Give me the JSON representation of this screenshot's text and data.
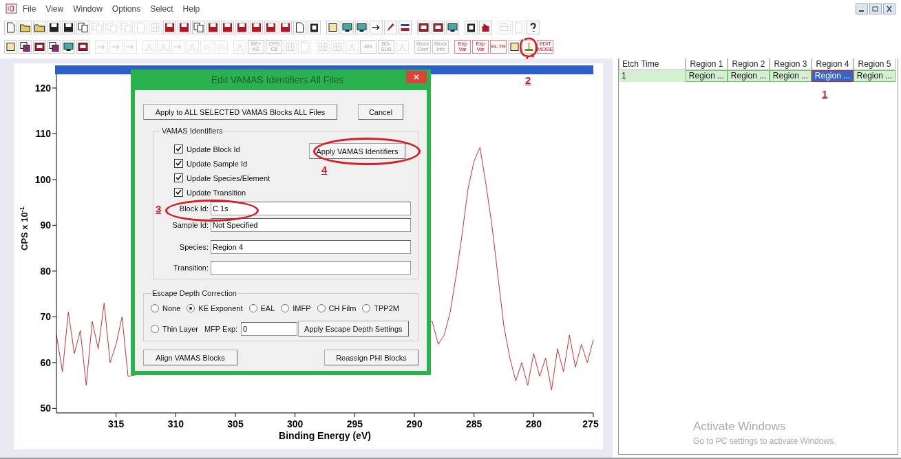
{
  "menu_bar": {
    "items": [
      "File",
      "View",
      "Window",
      "Options",
      "Select",
      "Help"
    ]
  },
  "toolbars": [
    {
      "groups": [
        {
          "items": [
            {
              "kind": "icon",
              "disabled": false
            },
            {
              "kind": "icon",
              "disabled": false
            },
            {
              "kind": "icon",
              "disabled": false
            },
            {
              "kind": "icon",
              "disabled": false
            },
            {
              "kind": "icon",
              "disabled": false
            },
            {
              "kind": "icon",
              "disabled": false
            },
            {
              "kind": "icon",
              "disabled": true
            },
            {
              "kind": "icon",
              "disabled": true
            },
            {
              "kind": "icon",
              "disabled": true
            },
            {
              "kind": "icon",
              "disabled": true
            },
            {
              "kind": "icon",
              "disabled": true
            },
            {
              "kind": "icon",
              "disabled": false
            },
            {
              "kind": "icon",
              "disabled": false
            },
            {
              "kind": "icon",
              "disabled": false
            },
            {
              "kind": "icon",
              "disabled": false
            },
            {
              "kind": "icon",
              "disabled": false
            },
            {
              "kind": "icon",
              "disabled": false
            },
            {
              "kind": "icon",
              "disabled": false
            },
            {
              "kind": "icon",
              "disabled": false
            },
            {
              "kind": "icon",
              "disabled": false
            },
            {
              "kind": "icon",
              "disabled": false
            },
            {
              "kind": "icon",
              "disabled": false
            }
          ]
        },
        {
          "items": [
            {
              "kind": "icon",
              "disabled": false
            },
            {
              "kind": "icon",
              "disabled": false
            },
            {
              "kind": "icon",
              "disabled": false
            },
            {
              "kind": "icon",
              "disabled": false
            },
            {
              "kind": "icon",
              "disabled": false
            },
            {
              "kind": "icon",
              "disabled": false
            }
          ]
        },
        {
          "items": [
            {
              "kind": "icon",
              "disabled": false
            },
            {
              "kind": "icon",
              "disabled": false
            },
            {
              "kind": "icon",
              "disabled": false
            }
          ]
        },
        {
          "items": [
            {
              "kind": "icon",
              "disabled": false
            },
            {
              "kind": "icon",
              "disabled": false
            }
          ]
        },
        {
          "items": [
            {
              "kind": "icon",
              "disabled": true
            },
            {
              "kind": "icon",
              "disabled": true
            },
            {
              "kind": "icon",
              "disabled": false
            }
          ]
        }
      ]
    },
    {
      "groups": [
        {
          "items": [
            {
              "kind": "icon",
              "disabled": false
            },
            {
              "kind": "icon",
              "disabled": false
            },
            {
              "kind": "icon",
              "disabled": false
            },
            {
              "kind": "icon",
              "disabled": false
            },
            {
              "kind": "icon",
              "disabled": false
            },
            {
              "kind": "icon",
              "disabled": false
            }
          ]
        },
        {
          "items": [
            {
              "kind": "icon",
              "disabled": true
            },
            {
              "kind": "icon",
              "disabled": true
            },
            {
              "kind": "icon",
              "disabled": true
            }
          ]
        },
        {
          "items": [
            {
              "kind": "icon",
              "disabled": true
            },
            {
              "kind": "icon",
              "disabled": true
            },
            {
              "kind": "icon",
              "disabled": true
            },
            {
              "kind": "icon",
              "disabled": true
            },
            {
              "kind": "icon",
              "disabled": true
            },
            {
              "kind": "icon",
              "disabled": true
            }
          ]
        },
        {
          "items": [
            {
              "kind": "icon",
              "disabled": true
            },
            {
              "kind": "text",
              "label": "BE+ KE",
              "disabled": true
            },
            {
              "kind": "text",
              "label": "CPS C$",
              "disabled": true
            },
            {
              "kind": "icon",
              "disabled": true
            },
            {
              "kind": "icon",
              "disabled": true
            }
          ]
        },
        {
          "items": [
            {
              "kind": "icon",
              "disabled": true
            },
            {
              "kind": "icon",
              "disabled": true
            },
            {
              "kind": "icon",
              "disabled": true
            },
            {
              "kind": "text",
              "label": "BG",
              "disabled": true
            },
            {
              "kind": "text",
              "label": "BG- SUB",
              "disabled": true
            },
            {
              "kind": "icon",
              "disabled": true
            }
          ]
        },
        {
          "items": [
            {
              "kind": "text",
              "label": "Block Cont",
              "disabled": true
            },
            {
              "kind": "text",
              "label": "Block Info",
              "disabled": true
            }
          ]
        },
        {
          "items": [
            {
              "kind": "text",
              "label": "Exp Var",
              "disabled": false
            },
            {
              "kind": "text",
              "label": "Exp Var",
              "disabled": false
            },
            {
              "kind": "text",
              "label": "EL TR",
              "disabled": false
            },
            {
              "kind": "icon",
              "disabled": false
            },
            {
              "kind": "icon",
              "disabled": false
            },
            {
              "kind": "text",
              "label": "EDIT MODE",
              "disabled": false
            }
          ]
        }
      ]
    }
  ],
  "chart": {
    "chart_data": {
      "type": "line",
      "xlabel": "Binding Energy (eV)",
      "ylabel": "CPS x 10$^{-1}$",
      "xlim": [
        320,
        275
      ],
      "ylim": [
        49,
        123
      ],
      "xticks": [
        315,
        310,
        305,
        300,
        295,
        290,
        285,
        280,
        275
      ],
      "yticks": [
        120,
        110,
        100,
        90,
        80,
        70,
        60,
        50
      ],
      "x": [
        320,
        319.5,
        319,
        318.5,
        318,
        317.5,
        317,
        316.5,
        316,
        315.5,
        315,
        314.5,
        314,
        288.5,
        288,
        287.5,
        287,
        286.5,
        286,
        285.5,
        285,
        284.5,
        284,
        283.5,
        283,
        282.5,
        282,
        281.5,
        281,
        280.5,
        280,
        279.5,
        279,
        278.5,
        278,
        277.5,
        277,
        276.5,
        276,
        275.5,
        275
      ],
      "series": [
        {
          "color": "#c41820",
          "values": [
            66,
            58,
            71,
            62,
            67,
            55,
            69,
            63,
            73,
            60,
            64,
            70,
            57,
            69,
            64,
            66,
            71,
            79,
            88,
            98,
            104,
            107,
            99,
            90,
            79,
            68,
            61,
            56,
            60,
            55,
            62,
            57,
            61,
            54,
            63,
            58,
            66,
            59,
            64,
            60,
            65
          ]
        }
      ]
    }
  },
  "dialog": {
    "title": "Edit VAMAS  Identifiers All Files",
    "apply_all_button": "Apply to ALL SELECTED VAMAS Blocks ALL Files",
    "cancel_button": "Cancel",
    "identifiers_group": {
      "legend": "VAMAS Identifiers",
      "checkboxes": [
        {
          "label": "Update Block Id",
          "checked": true
        },
        {
          "label": "Update Sample Id",
          "checked": true
        },
        {
          "label": "Update Species/Element",
          "checked": true
        },
        {
          "label": "Update Transition",
          "checked": true
        }
      ],
      "apply_button": "Apply VAMAS Identifiers",
      "fields": [
        {
          "label": "Block Id:",
          "value": "C 1s"
        },
        {
          "label": "Sample Id:",
          "value": "Not Specified"
        },
        {
          "label": "Species:",
          "value": "Region 4"
        },
        {
          "label": "Transition:"
        }
      ]
    },
    "escape_group": {
      "legend": "Escape Depth Correction",
      "options": [
        {
          "label": "None",
          "selected": false
        },
        {
          "label": "KE Exponent",
          "selected": true
        },
        {
          "label": "EAL",
          "selected": false
        },
        {
          "label": "IMFP",
          "selected": false
        },
        {
          "label": "CH Film",
          "selected": false
        },
        {
          "label": "TPP2M",
          "selected": false
        },
        {
          "label": "Thin Layer",
          "selected": false
        }
      ],
      "mfp_label": "MFP Exp:",
      "mfp_value": "0",
      "apply_button": "Apply Escape Depth Settings"
    },
    "align_button": "Align VAMAS Blocks",
    "reassign_button": "Reassign PHI Blocks"
  },
  "table": {
    "columns": [
      "Etch Time",
      "Region 1",
      "Region 2",
      "Region 3",
      "Region 4",
      "Region 5"
    ],
    "rows": [
      {
        "selected": true,
        "cells": [
          {
            "text": "1",
            "selected": false
          },
          {
            "text": "Region ...",
            "selected": false
          },
          {
            "text": "Region ...",
            "selected": false
          },
          {
            "text": "Region ...",
            "selected": false
          },
          {
            "text": "Region ...",
            "selected": true
          },
          {
            "text": "Region ...",
            "selected": false
          }
        ]
      }
    ]
  },
  "activation_notice": {
    "title": "Activate Windows",
    "message": "Go to PC settings to activate Windows."
  },
  "annotations": [
    {
      "kind": "ring"
    },
    {
      "kind": "ring"
    },
    {
      "kind": "scribble"
    },
    {
      "kind": "number",
      "label": "1"
    },
    {
      "kind": "number",
      "label": "2"
    },
    {
      "kind": "number",
      "label": "3"
    },
    {
      "kind": "number",
      "label": "4"
    }
  ]
}
